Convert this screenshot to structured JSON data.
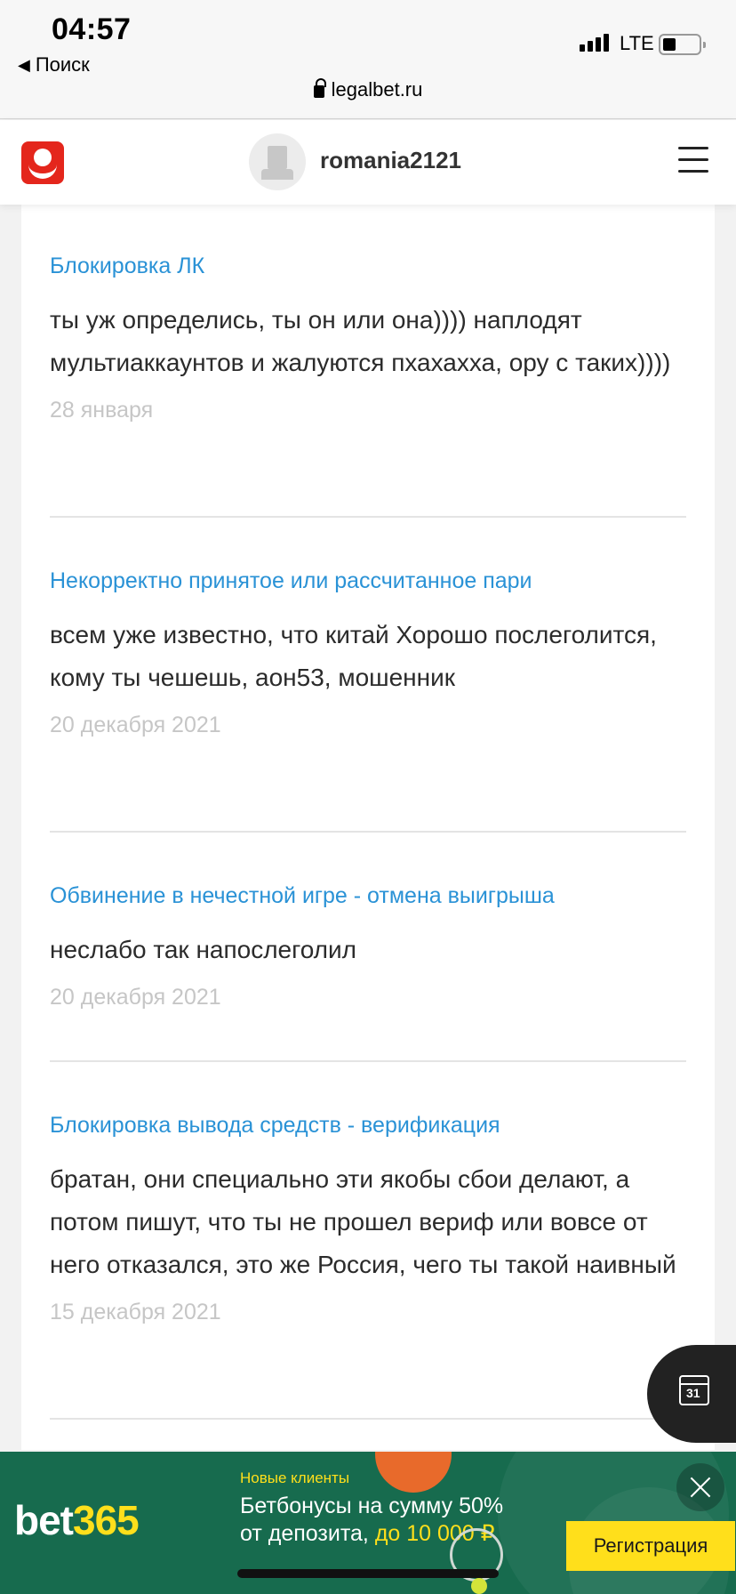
{
  "status_bar": {
    "time": "04:57",
    "back_label": "Поиск",
    "network": "LTE",
    "url": "legalbet.ru"
  },
  "header": {
    "username": "romania2121"
  },
  "entries": [
    {
      "title": "Блокировка ЛК",
      "text": "ты уж определись, ты он или она)))) наплодят мультиаккаунтов и жалуются пхахахха, ору с таких))))",
      "date": "28 января"
    },
    {
      "title": "Некорректно принятое или рассчитанное пари",
      "text": "всем уже известно, что китай Хорошо послеголится, кому ты чешешь, аон53, мошенник",
      "date": "20 декабря 2021"
    },
    {
      "title": "Обвинение в нечестной игре - отмена выигрыша",
      "text": "неслабо так напослеголил",
      "date": "20 декабря 2021"
    },
    {
      "title": "Блокировка вывода средств - верификация",
      "text": "братан, они специально эти якобы сбои делают, а потом пишут, что ты не прошел вериф или вовсе от него отказался, это же Россия, чего ты такой наивный",
      "date": "15 декабря 2021"
    }
  ],
  "fab": {
    "icon": "calendar-icon",
    "number": "31"
  },
  "ad": {
    "brand_white": "bet",
    "brand_yellow": "365",
    "small_text": "Новые клиенты",
    "headline": "Бетбонусы на сумму 50% от депозита,",
    "headline_em": "до 10 000 ₽",
    "button": "Регистрация",
    "accent_color": "#ffdf1b",
    "bg_color": "#176b4e"
  },
  "colors": {
    "link": "#2a92d6",
    "date": "#c6c6c6",
    "logo": "#e4261c"
  }
}
